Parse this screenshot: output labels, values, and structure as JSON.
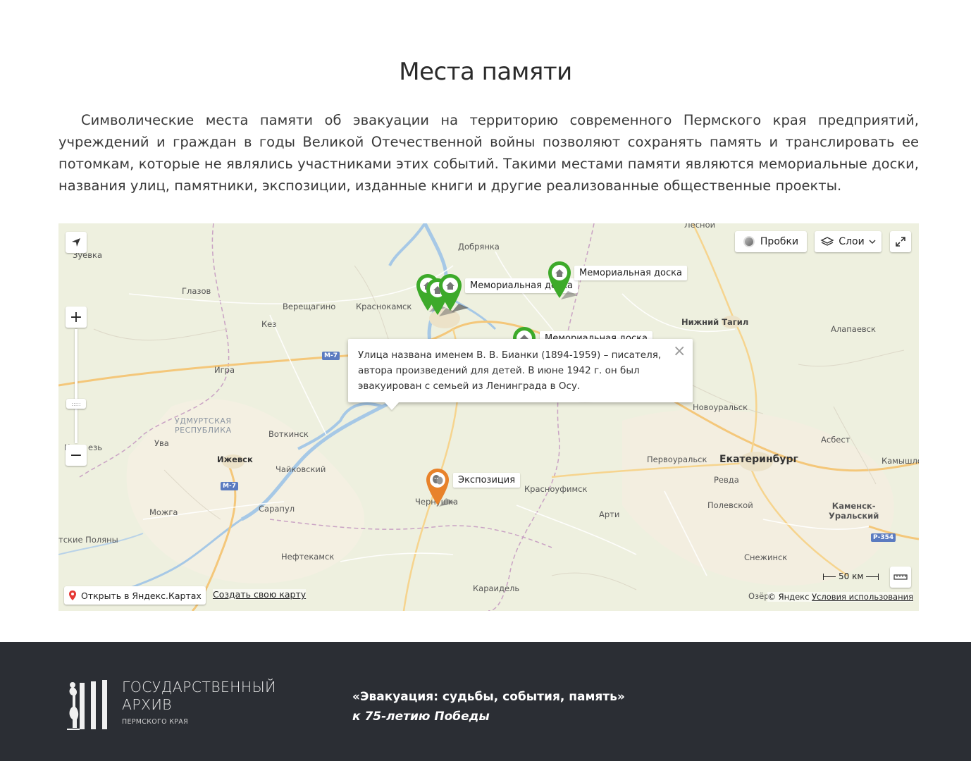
{
  "page": {
    "title": "Места памяти",
    "intro": "Символические места памяти об эвакуации на территорию современного Пермского края предприятий, учреждений и граждан в годы Великой Отечественной войны позволяют сохранять память и транслировать ее потомкам, которые не являлись участниками этих событий. Такими местами памяти являются мемориальные доски, названия улиц, памятники, экспозиции, изданные книги и другие реализованные общественные проекты."
  },
  "map": {
    "controls": {
      "traffic_label": "Пробки",
      "layers_label": "Слои",
      "zoom_in": "+",
      "zoom_out": "−",
      "scale_label": "50 км",
      "open_yandex": "Открыть в Яндекс.Картах",
      "create_map": "Создать свою карту",
      "copyright": "© Яндекс",
      "terms": "Условия использования"
    },
    "places": {
      "dobryanka": "Добрянка",
      "lesnoy": "Лесной",
      "zuevka": "Зуевка",
      "glazov": "Глазов",
      "vereshchagino": "Верещагино",
      "krasnokamsk": "Краснокамск",
      "kez": "Кез",
      "igra": "Игра",
      "udmurtia_1": "УДМУРТСКАЯ",
      "udmurtia_2": "РЕСПУБЛИКА",
      "uva": "Ува",
      "votkinsk": "Воткинск",
      "izhevsk": "Ижевск",
      "chaykovsky": "Чайковский",
      "mozhga": "Можга",
      "sarapul": "Сарапул",
      "polyany": "тские Поляны",
      "neftekamsk": "Нефтекамск",
      "chernushka": "Чернушка",
      "krasnoufimsk": "Красноуфимск",
      "arti": "Арти",
      "karaidel": "Караидель",
      "nizhny_tagil": "Нижний Тагил",
      "alapaevsk": "Алапаевск",
      "novouralsk": "Новоуральск",
      "asbest": "Асбест",
      "pervouralsk": "Первоуральск",
      "ekaterinburg": "Екатеринбург",
      "kamyshlov": "Камышло",
      "revda": "Ревда",
      "polevskoy": "Полевской",
      "kamensk_1": "Каменск-",
      "kamensk_2": "Уральский",
      "snezhinsk": "Снежинск",
      "ozersk": "Озёр",
      "kez_short": "К",
      "kez_tail": "езь",
      "road_m7": "М-7",
      "road_m7b": "М-7",
      "road_r354": "Р-354"
    },
    "markers": [
      {
        "label": "Мемориальная доска",
        "color": "#3daa2a",
        "icon": "house-icon"
      },
      {
        "label": "Мемориальная доска",
        "color": "#3daa2a",
        "icon": "house-icon"
      },
      {
        "label": "Мемориальная доска",
        "color": "#3daa2a",
        "icon": "house-icon"
      },
      {
        "label": "Экспозиция",
        "color": "#e8822a",
        "icon": "theater-masks-icon"
      }
    ],
    "balloon": {
      "text": "Улица названа именем В. В. Бианки (1894-1959) – писателя, автора произведений для детей. В июне 1942 г. он был эвакуирован с семьей из Ленинграда в Осу."
    }
  },
  "footer": {
    "logo_line1": "Государственный",
    "logo_line2": "архив",
    "logo_line3": "Пермского края",
    "project_title": "«Эвакуация: судьбы, события, память»",
    "project_subtitle": "к 75-летию Победы"
  }
}
